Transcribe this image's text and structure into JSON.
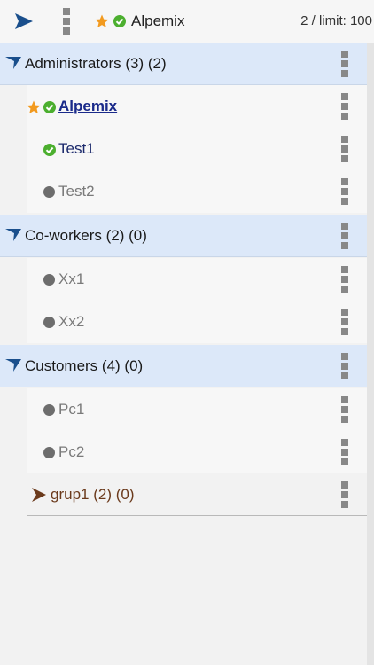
{
  "colors": {
    "accent_blue": "#1a4f8c",
    "group_bg": "#dce8f9",
    "online_green": "#4caf2f",
    "star_orange": "#f29a1f",
    "offline_grey": "#6d6d6d",
    "link_blue": "#1a2a8a",
    "folder_brown": "#6b3a1c"
  },
  "header": {
    "send_icon": "send-arrow-icon",
    "menu_icon": "kebab-menu-icon",
    "user_name": "Alpemix",
    "count_text": "2 / limit: 100"
  },
  "groups": [
    {
      "label": "Administrators (3) (2)",
      "members": [
        {
          "name": "Alpemix",
          "status": "online",
          "favorite": true,
          "current": true
        },
        {
          "name": "Test1",
          "status": "online",
          "favorite": false
        },
        {
          "name": "Test2",
          "status": "offline",
          "favorite": false
        }
      ]
    },
    {
      "label": "Co-workers (2) (0)",
      "members": [
        {
          "name": "Xx1",
          "status": "offline"
        },
        {
          "name": "Xx2",
          "status": "offline"
        }
      ]
    },
    {
      "label": "Customers (4) (0)",
      "members": [
        {
          "name": "Pc1",
          "status": "offline"
        },
        {
          "name": "Pc2",
          "status": "offline"
        }
      ],
      "subgroups": [
        {
          "label": "grup1 (2) (0)",
          "collapsed": true
        }
      ]
    }
  ]
}
